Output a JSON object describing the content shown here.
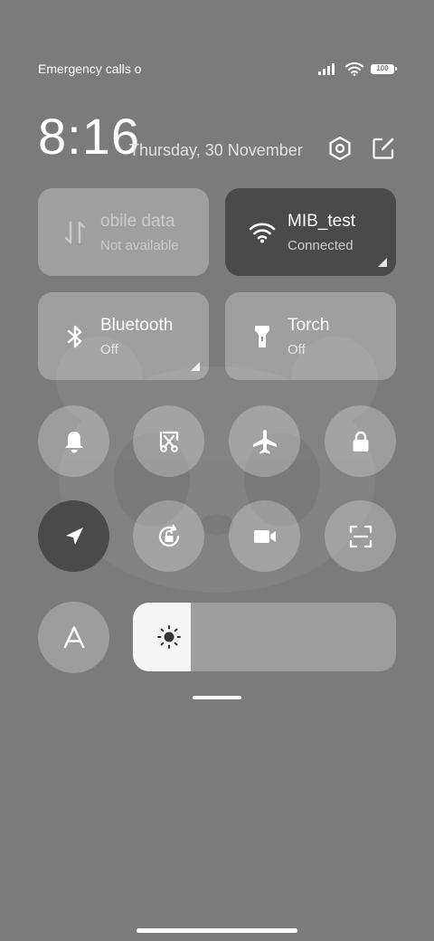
{
  "status_bar": {
    "carrier_text": "Emergency calls o",
    "battery_level": "100",
    "icons": [
      "signal-icon",
      "wifi-icon",
      "battery-icon"
    ]
  },
  "header": {
    "time": "8:16",
    "date": "Thursday, 30 November",
    "icons": [
      "settings-icon",
      "edit-icon"
    ]
  },
  "tiles": {
    "mobile_data": {
      "title": "obile data",
      "subtitle": "Not available",
      "active": false,
      "icon": "mobile-data-icon"
    },
    "wifi": {
      "title": "MIB_test",
      "subtitle": "Connected",
      "active": true,
      "icon": "wifi-icon"
    },
    "bluetooth": {
      "title": "Bluetooth",
      "subtitle": "Off",
      "active": false,
      "icon": "bluetooth-icon"
    },
    "torch": {
      "title": "Torch",
      "subtitle": "Off",
      "active": false,
      "icon": "torch-icon"
    }
  },
  "toggles_row1": [
    {
      "icon": "bell-icon",
      "active": false
    },
    {
      "icon": "screenshot-icon",
      "active": false
    },
    {
      "icon": "airplane-icon",
      "active": false
    },
    {
      "icon": "lock-icon",
      "active": false
    }
  ],
  "toggles_row2": [
    {
      "icon": "location-icon",
      "active": true
    },
    {
      "icon": "rotation-lock-icon",
      "active": false
    },
    {
      "icon": "video-camera-icon",
      "active": false
    },
    {
      "icon": "scan-icon",
      "active": false
    }
  ],
  "auto_brightness": {
    "label": "A",
    "icon": "auto-brightness-icon"
  },
  "brightness": {
    "level_fraction": 0.22,
    "icon": "sun-icon"
  },
  "colors": {
    "background": "#7b7b7b",
    "active_tile": "#4a4a4a",
    "tile": "rgba(255,255,255,0.28)",
    "text": "#ffffff"
  }
}
